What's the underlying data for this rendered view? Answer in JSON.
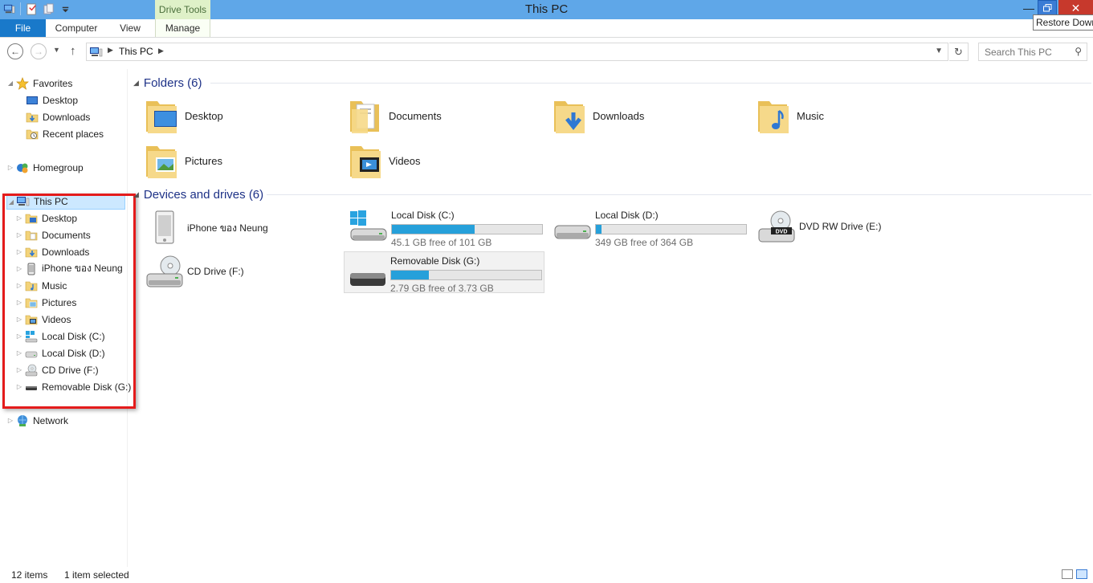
{
  "window": {
    "title": "This PC",
    "contextual_tab": "Drive Tools",
    "tooltip": "Restore Down",
    "colors": {
      "titlebar": "#5fa7e8",
      "file_tab": "#1979ca",
      "close": "#c7392c",
      "highlight_box": "#e41b1b",
      "progress": "#26a0da"
    }
  },
  "ribbon": {
    "tabs": [
      {
        "label": "File"
      },
      {
        "label": "Computer"
      },
      {
        "label": "View"
      },
      {
        "label": "Manage"
      }
    ]
  },
  "address": {
    "crumb": "This PC",
    "search_placeholder": "Search This PC"
  },
  "nav": {
    "favorites": {
      "label": "Favorites",
      "items": [
        "Desktop",
        "Downloads",
        "Recent places"
      ]
    },
    "homegroup": "Homegroup",
    "this_pc": {
      "label": "This PC",
      "items": [
        {
          "label": "Desktop",
          "icon": "desktop-folder-icon"
        },
        {
          "label": "Documents",
          "icon": "documents-folder-icon"
        },
        {
          "label": "Downloads",
          "icon": "downloads-folder-icon"
        },
        {
          "label": "iPhone ของ Neung",
          "icon": "iphone-icon"
        },
        {
          "label": "Music",
          "icon": "music-folder-icon"
        },
        {
          "label": "Pictures",
          "icon": "pictures-folder-icon"
        },
        {
          "label": "Videos",
          "icon": "videos-folder-icon"
        },
        {
          "label": "Local Disk (C:)",
          "icon": "windows-drive-icon"
        },
        {
          "label": "Local Disk (D:)",
          "icon": "hard-drive-icon"
        },
        {
          "label": "CD Drive (F:)",
          "icon": "cd-drive-icon"
        },
        {
          "label": "Removable Disk (G:)",
          "icon": "usb-drive-icon"
        }
      ]
    },
    "network": "Network"
  },
  "content": {
    "folders_header": "Folders (6)",
    "folders": [
      "Desktop",
      "Documents",
      "Downloads",
      "Music",
      "Pictures",
      "Videos"
    ],
    "devices_header": "Devices and drives (6)",
    "devices": [
      {
        "name": "iPhone ของ Neung"
      },
      {
        "name": "Local Disk (C:)",
        "free": "45.1 GB free of 101 GB",
        "used_fraction": 0.55
      },
      {
        "name": "Local Disk (D:)",
        "free": "349 GB free of 364 GB",
        "used_fraction": 0.04
      },
      {
        "name": "DVD RW Drive (E:)"
      },
      {
        "name": "CD Drive (F:)"
      },
      {
        "name": "Removable Disk (G:)",
        "free": "2.79 GB free of 3.73 GB",
        "used_fraction": 0.25
      }
    ]
  },
  "status": {
    "count": "12 items",
    "selected": "1 item selected"
  }
}
